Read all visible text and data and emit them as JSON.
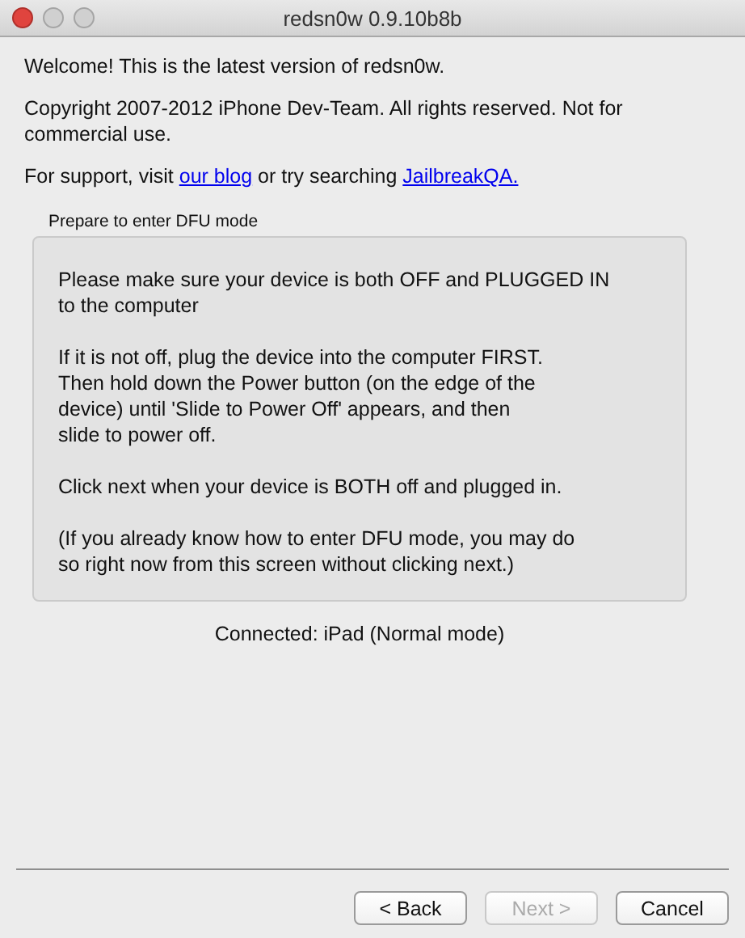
{
  "window": {
    "title": "redsn0w 0.9.10b8b"
  },
  "intro": [
    {
      "kind": "text",
      "text": "Welcome!  This is the latest version of redsn0w."
    },
    {
      "kind": "text",
      "text": "Copyright 2007-2012 iPhone Dev-Team. All rights reserved. Not for commercial use."
    },
    {
      "kind": "support",
      "before": "For support, visit ",
      "link1": "our blog",
      "middle": " or try searching ",
      "link2": "JailbreakQA."
    }
  ],
  "group": {
    "label": "Prepare to enter DFU mode",
    "paragraphs": [
      [
        "Please make sure your device is both OFF and PLUGGED IN",
        "to the computer"
      ],
      [
        "If it is not off, plug the device into the computer FIRST.",
        "Then hold down the Power button (on the edge of the",
        "device) until 'Slide to Power Off' appears, and then",
        "slide to power off."
      ],
      [
        "Click next when your device is BOTH off and plugged in."
      ],
      [
        "(If you already know how to enter DFU mode, you may do",
        "so right now from this screen without clicking next.)"
      ]
    ]
  },
  "status": "Connected: iPad (Normal mode)",
  "buttons": [
    {
      "label": "< Back",
      "disabled": false
    },
    {
      "label": "Next >",
      "disabled": true
    },
    {
      "label": "Cancel",
      "disabled": false
    }
  ]
}
